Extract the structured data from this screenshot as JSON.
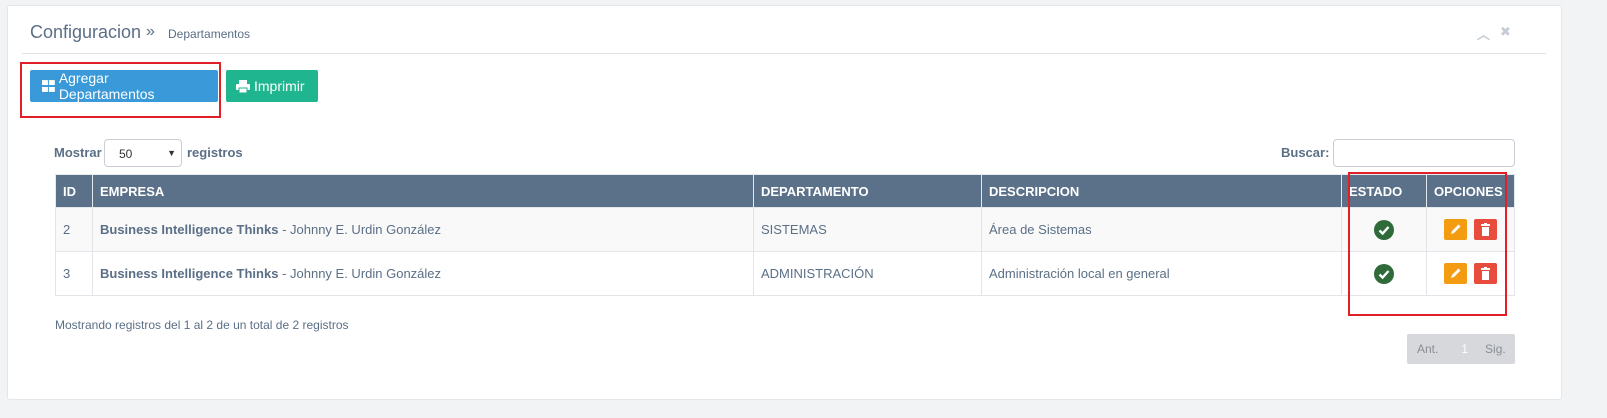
{
  "breadcrumb": {
    "section": "Configuracion",
    "separator": "»",
    "page": "Departamentos"
  },
  "header_controls": {
    "collapse_glyph": "︿",
    "close_glyph": "✖"
  },
  "toolbar": {
    "add_label": "Agregar Departamentos",
    "print_label": "Imprimir"
  },
  "length_control": {
    "prefix": "Mostrar",
    "value": "50",
    "suffix": "registros"
  },
  "search": {
    "label": "Buscar:",
    "value": ""
  },
  "table": {
    "columns": [
      "ID",
      "EMPRESA",
      "DEPARTAMENTO",
      "DESCRIPCION",
      "ESTADO",
      "OPCIONES"
    ],
    "rows": [
      {
        "id": "2",
        "company": "Business Intelligence Thinks",
        "owner": " - Johnny E. Urdin González",
        "department": "SISTEMAS",
        "description": "Área de Sistemas",
        "status": "active"
      },
      {
        "id": "3",
        "company": "Business Intelligence Thinks",
        "owner": " - Johnny E. Urdin González",
        "department": "ADMINISTRACIÓN",
        "description": "Administración local en general",
        "status": "active"
      }
    ]
  },
  "footer": {
    "info": "Mostrando registros del 1 al 2 de un total de 2 registros"
  },
  "pagination": {
    "prev": "Ant.",
    "current": "1",
    "next": "Sig."
  },
  "colors": {
    "primary": "#3a9ad9",
    "success": "#1fb58f",
    "header_bg": "#5b7189",
    "warning": "#f39c12",
    "danger": "#e74c3c",
    "status_ok": "#2f6b3a",
    "highlight": "#e01f26"
  },
  "icons": {
    "add": "grid-icon",
    "print": "printer-icon",
    "status": "check-circle-icon",
    "edit": "pencil-icon",
    "delete": "trash-icon"
  }
}
